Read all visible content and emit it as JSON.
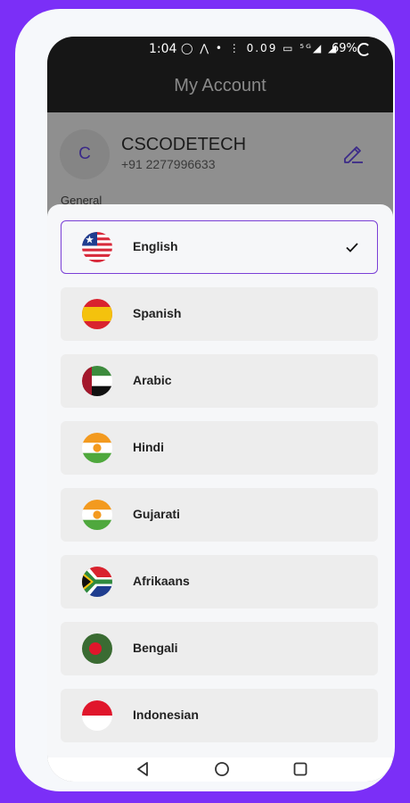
{
  "status_bar": {
    "time": "1:04",
    "icons_text": "◯ ⋀ • ⋮ 0.09 ▭ ⁵ᴳ◢ ◢",
    "battery": "69%"
  },
  "app_bar": {
    "title": "My Account"
  },
  "profile": {
    "avatar_initial": "C",
    "name": "CSCODETECH",
    "phone": "+91 2277996633",
    "edit_icon": "pencil-edit-icon"
  },
  "section_label": "General",
  "languages": [
    {
      "label": "English",
      "flag": "liberia-flag-icon",
      "selected": true
    },
    {
      "label": "Spanish",
      "flag": "spain-flag-icon",
      "selected": false
    },
    {
      "label": "Arabic",
      "flag": "uae-flag-icon",
      "selected": false
    },
    {
      "label": "Hindi",
      "flag": "niger-flag-icon",
      "selected": false
    },
    {
      "label": "Gujarati",
      "flag": "niger-flag-icon",
      "selected": false
    },
    {
      "label": "Afrikaans",
      "flag": "south-africa-flag-icon",
      "selected": false
    },
    {
      "label": "Bengali",
      "flag": "bangladesh-flag-icon",
      "selected": false
    },
    {
      "label": "Indonesian",
      "flag": "indonesia-flag-icon",
      "selected": false
    }
  ],
  "nav": {
    "back": "back-icon",
    "home": "home-icon",
    "recents": "recents-icon"
  },
  "colors": {
    "background": "#7b2ff7",
    "accent": "#7a3fd6",
    "app_bar": "#161616",
    "item_bg": "#ededed"
  }
}
